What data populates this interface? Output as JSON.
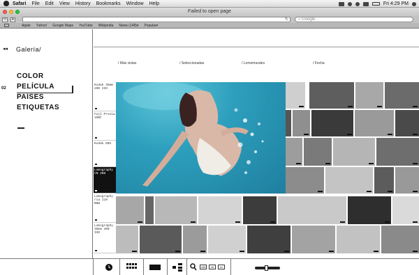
{
  "menubar": {
    "app_name": "Safari",
    "items": [
      "File",
      "Edit",
      "View",
      "History",
      "Bookmarks",
      "Window",
      "Help"
    ],
    "clock": "Fri 4:29 PM"
  },
  "window": {
    "title": "Failed to open page"
  },
  "search": {
    "placeholder": "Google"
  },
  "bookmarks": [
    "Apple",
    "Yahoo!",
    "Google Maps",
    "YouTube",
    "Wikipedia",
    "News (148)▾",
    "Popular▾"
  ],
  "site": {
    "breadcrumb": "Galería/",
    "nav_number": "02",
    "nav": [
      "COLOR",
      "PELÍCULA",
      "PAÍSES",
      "ETIQUETAS"
    ],
    "active_nav": "PELÍCULA",
    "sort_tabs": [
      "/ Más vistas",
      "/ Seleccionadas",
      "/ Lomomurales",
      "/ Fecha"
    ],
    "film_rows": [
      "Kodak 35mm\n200 ISO",
      "Fuji Provia\n100F",
      "Kodak EBX",
      "Lomography\nCN 400",
      "Lomography\nrca 110\nB&W",
      "Lomography\n35mm 400\nISO"
    ],
    "active_row": "Lomography\nCN 400"
  },
  "footer": {
    "zoom_buttons": [
      "x50",
      "x6",
      "x1"
    ]
  },
  "colors": {
    "accent": "#111111",
    "water": "#2d9fbd"
  }
}
